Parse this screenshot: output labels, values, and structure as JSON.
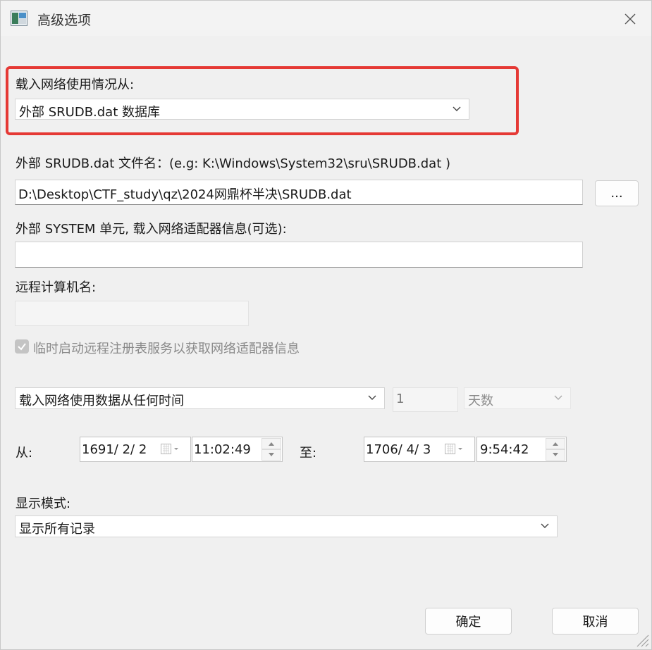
{
  "window": {
    "title": "高级选项"
  },
  "load_from": {
    "label": "载入网络使用情况从:",
    "selected": "外部 SRUDB.dat 数据库"
  },
  "srudb": {
    "label": "外部 SRUDB.dat 文件名：(e.g: K:\\Windows\\System32\\sru\\SRUDB.dat )",
    "value": "D:\\Desktop\\CTF_study\\qz\\2024网鼎杯半决\\SRUDB.dat",
    "browse_label": "..."
  },
  "system_hive": {
    "label": "外部 SYSTEM 单元, 载入网络适配器信息(可选):",
    "value": ""
  },
  "remote": {
    "label": "远程计算机名:",
    "value": ""
  },
  "remote_registry": {
    "label": "临时启动远程注册表服务以获取网络适配器信息",
    "checked": true
  },
  "time_range": {
    "mode_selected": "载入网络使用数据从任何时间",
    "count_value": "1",
    "unit_selected": "天数"
  },
  "range": {
    "from_label": "从:",
    "from_date": "1691/  2/  2",
    "from_time": "11:02:49",
    "to_label": "至:",
    "to_date": "1706/  4/  3",
    "to_time": "9:54:42"
  },
  "display": {
    "label": "显示模式:",
    "selected": "显示所有记录"
  },
  "buttons": {
    "ok": "确定",
    "cancel": "取消"
  },
  "colors": {
    "highlight": "#e53935",
    "background": "#f0f0f0"
  }
}
